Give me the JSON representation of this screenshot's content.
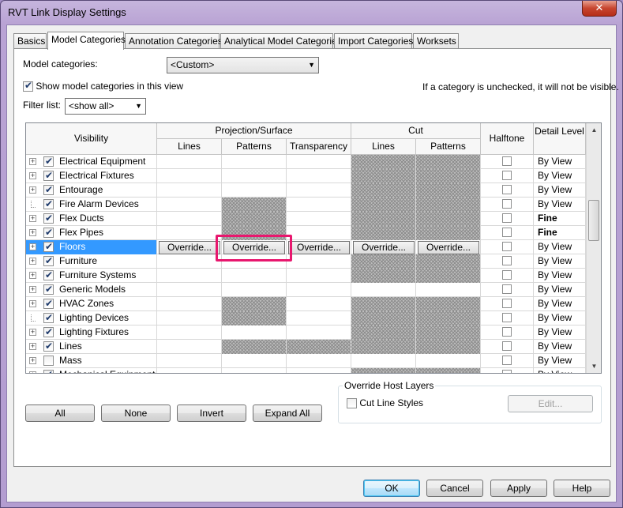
{
  "window": {
    "title": "RVT Link Display Settings",
    "close_glyph": "✕"
  },
  "tabs": [
    "Basics",
    "Model Categories",
    "Annotation Categories",
    "Analytical Model Categories",
    "Import Categories",
    "Worksets"
  ],
  "model_categories_label": "Model categories:",
  "model_categories_value": "<Custom>",
  "show_in_view_label": "Show model categories in this view",
  "hint": "If a category is unchecked, it will not be visible.",
  "filter_label": "Filter list:",
  "filter_value": "<show all>",
  "grid": {
    "headers": {
      "visibility": "Visibility",
      "projection": "Projection/Surface",
      "cut": "Cut",
      "halftone": "Halftone",
      "detail": "Detail Level",
      "lines": "Lines",
      "patterns": "Patterns",
      "transparency": "Transparency",
      "cut_lines": "Lines",
      "cut_patterns": "Patterns"
    },
    "override_label": "Override...",
    "rows": [
      {
        "name": "Electrical Equipment",
        "checked": true,
        "expandable": true,
        "hatch": [
          0,
          0,
          0,
          1,
          1
        ],
        "detail": "By View"
      },
      {
        "name": "Electrical Fixtures",
        "checked": true,
        "expandable": true,
        "hatch": [
          0,
          0,
          0,
          1,
          1
        ],
        "detail": "By View"
      },
      {
        "name": "Entourage",
        "checked": true,
        "expandable": true,
        "hatch": [
          0,
          0,
          0,
          1,
          1
        ],
        "detail": "By View"
      },
      {
        "name": "Fire Alarm Devices",
        "checked": true,
        "expandable": false,
        "hatch": [
          0,
          1,
          0,
          1,
          1
        ],
        "detail": "By View"
      },
      {
        "name": "Flex Ducts",
        "checked": true,
        "expandable": true,
        "hatch": [
          0,
          1,
          0,
          1,
          1
        ],
        "detail": "Fine"
      },
      {
        "name": "Flex Pipes",
        "checked": true,
        "expandable": true,
        "hatch": [
          0,
          1,
          0,
          1,
          1
        ],
        "detail": "Fine"
      },
      {
        "name": "Floors",
        "checked": true,
        "expandable": true,
        "hatch": [
          0,
          0,
          0,
          0,
          0
        ],
        "detail": "By View",
        "selected": true
      },
      {
        "name": "Furniture",
        "checked": true,
        "expandable": true,
        "hatch": [
          0,
          0,
          0,
          1,
          1
        ],
        "detail": "By View"
      },
      {
        "name": "Furniture Systems",
        "checked": true,
        "expandable": true,
        "hatch": [
          0,
          0,
          0,
          1,
          1
        ],
        "detail": "By View"
      },
      {
        "name": "Generic Models",
        "checked": true,
        "expandable": true,
        "hatch": [
          0,
          0,
          0,
          0,
          0
        ],
        "detail": "By View"
      },
      {
        "name": "HVAC Zones",
        "checked": true,
        "expandable": true,
        "hatch": [
          0,
          1,
          0,
          1,
          1
        ],
        "detail": "By View"
      },
      {
        "name": "Lighting Devices",
        "checked": true,
        "expandable": false,
        "hatch": [
          0,
          1,
          0,
          1,
          1
        ],
        "detail": "By View"
      },
      {
        "name": "Lighting Fixtures",
        "checked": true,
        "expandable": true,
        "hatch": [
          0,
          0,
          0,
          1,
          1
        ],
        "detail": "By View"
      },
      {
        "name": "Lines",
        "checked": true,
        "expandable": true,
        "hatch": [
          0,
          1,
          1,
          1,
          1
        ],
        "detail": "By View"
      },
      {
        "name": "Mass",
        "checked": false,
        "expandable": true,
        "hatch": [
          0,
          0,
          0,
          0,
          0
        ],
        "detail": "By View"
      },
      {
        "name": "Mechanical Equipment",
        "checked": true,
        "expandable": true,
        "hatch": [
          0,
          0,
          0,
          1,
          1
        ],
        "detail": "By View"
      }
    ]
  },
  "buttons": {
    "all": "All",
    "none": "None",
    "invert": "Invert",
    "expand_all": "Expand All"
  },
  "override_host": {
    "title": "Override Host Layers",
    "cut_line_styles": "Cut Line Styles",
    "edit": "Edit..."
  },
  "footer": {
    "ok": "OK",
    "cancel": "Cancel",
    "apply": "Apply",
    "help": "Help"
  }
}
